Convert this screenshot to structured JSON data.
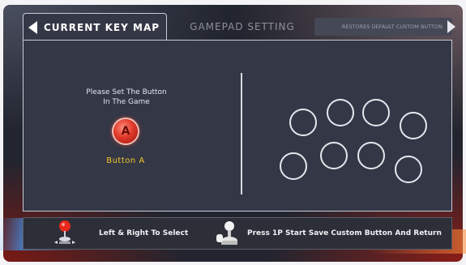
{
  "tabs": {
    "current": "CURRENT KEY MAP",
    "gamepad": "GAMEPAD SETTING",
    "restore": "RESTORES DEFAULT CUSTOM BUTTON"
  },
  "main": {
    "prompt": "Please Set The Button\nIn The Game",
    "key_letter": "A",
    "button_name": "Button  A"
  },
  "footer": {
    "hint_select": "Left & Right To Select",
    "hint_start": "Press 1P Start Save Custom Button And Return"
  },
  "icons": {
    "left_arrow": "left-arrow-icon",
    "right_arrow": "right-arrow-icon",
    "joystick": "joystick-icon",
    "start_stick": "arcade-stick-icon"
  },
  "colors": {
    "panel_bg": "#343746",
    "button_name": "#f1c52b",
    "key_button": "#e13a2a"
  }
}
